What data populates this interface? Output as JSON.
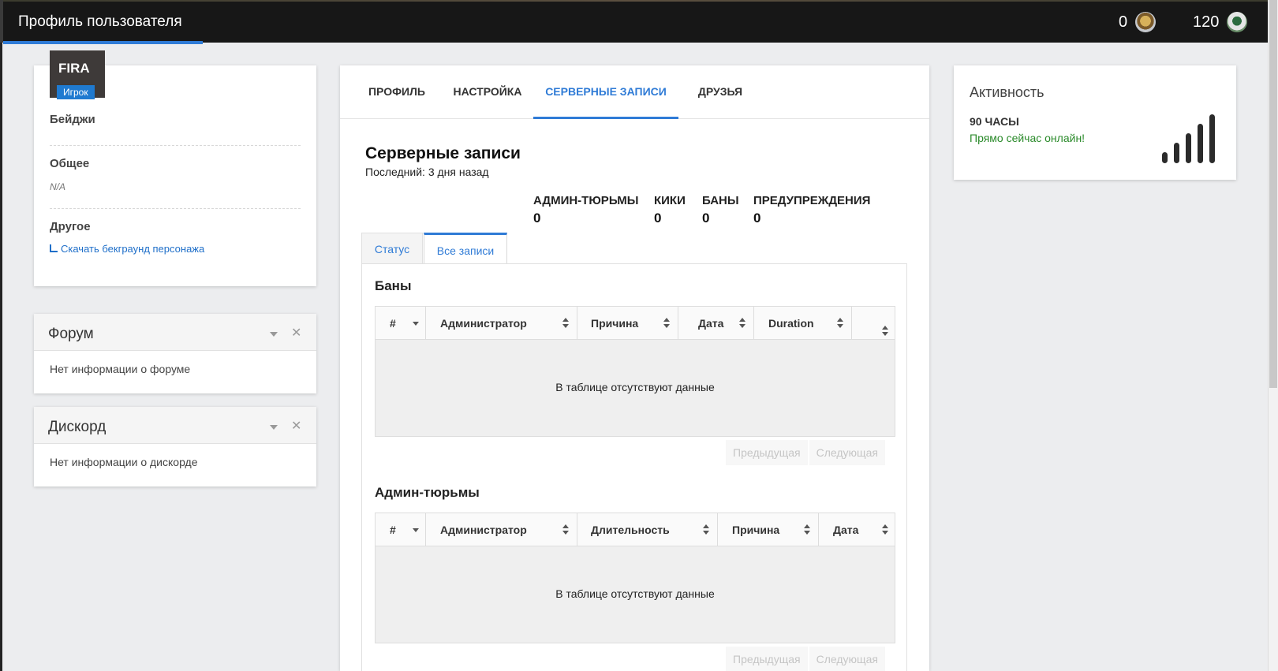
{
  "header": {
    "title": "Профиль пользователя",
    "coin1": "0",
    "coin2": "120"
  },
  "profile": {
    "nick": "FIRA",
    "role": "Игрок",
    "badges_label": "Бейджи",
    "general_label": "Общее",
    "general_value": "N/A",
    "other_label": "Другое",
    "download_link": "Скачать бекграунд персонажа"
  },
  "forum": {
    "title": "Форум",
    "text": "Нет информации о форуме"
  },
  "discord": {
    "title": "Дискорд",
    "text": "Нет информации о дискорде"
  },
  "tabs": [
    "ПРОФИЛЬ",
    "НАСТРОЙКА",
    "СЕРВЕРНЫЕ ЗАПИСИ",
    "ДРУЗЬЯ"
  ],
  "records": {
    "title": "Серверные записи",
    "last": "Последний: 3 дня назад",
    "stats": [
      {
        "label": "АДМИН-ТЮРЬМЫ",
        "value": "0"
      },
      {
        "label": "КИКИ",
        "value": "0"
      },
      {
        "label": "БАНЫ",
        "value": "0"
      },
      {
        "label": "ПРЕДУПРЕЖДЕНИЯ",
        "value": "0"
      }
    ],
    "subtabs": [
      "Статус",
      "Все записи"
    ],
    "bans": {
      "title": "Баны",
      "columns": [
        "#",
        "Администратор",
        "Причина",
        "Дата",
        "Duration",
        ""
      ],
      "empty": "В таблице отсутствуют данные"
    },
    "jails": {
      "title": "Админ-тюрьмы",
      "columns": [
        "#",
        "Администратор",
        "Длительность",
        "Причина",
        "Дата"
      ],
      "empty": "В таблице отсутствуют данные"
    },
    "pager": {
      "prev": "Предыдущая",
      "next": "Следующая"
    }
  },
  "activity": {
    "title": "Активность",
    "hours": "90 ЧАСЫ",
    "online": "Прямо сейчас онлайн!",
    "level": 5
  }
}
